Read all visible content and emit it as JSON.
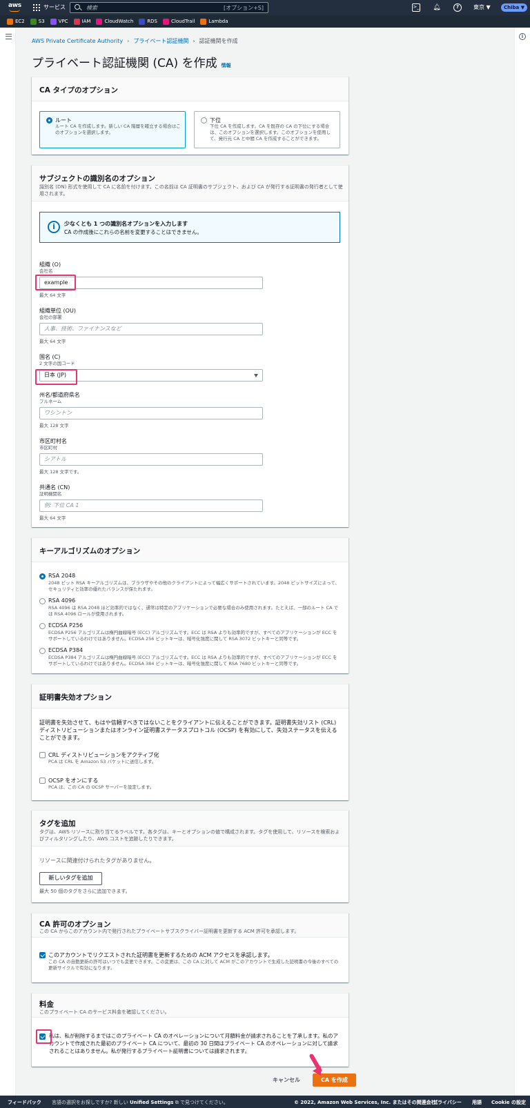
{
  "topnav": {
    "logo": "aws",
    "services": "サービス",
    "search_placeholder": "検索",
    "search_shortcut": "[オプション+S]",
    "region": "東京 ▼",
    "user": "Chiba ▼"
  },
  "favorites": [
    {
      "label": "EC2",
      "color": "#ec7211"
    },
    {
      "label": "S3",
      "color": "#3f8624"
    },
    {
      "label": "VPC",
      "color": "#8c4fff"
    },
    {
      "label": "IAM",
      "color": "#dd344c"
    },
    {
      "label": "CloudWatch",
      "color": "#e7157b"
    },
    {
      "label": "RDS",
      "color": "#3b48cc"
    },
    {
      "label": "CloudTrail",
      "color": "#e7157b"
    },
    {
      "label": "Lambda",
      "color": "#ec7211"
    }
  ],
  "breadcrumb": {
    "root": "AWS Private Certificate Authority",
    "parent": "プライベート認証機関",
    "current": "認証機関を作成"
  },
  "page": {
    "title": "プライベート認証機関 (CA) を作成",
    "info": "情報"
  },
  "ca_type": {
    "title": "CA タイプのオプション",
    "root": {
      "label": "ルート",
      "desc": "ルート CA を作成します。新しい CA 階層を確立する場合はこのオプションを選択します。"
    },
    "sub": {
      "label": "下位",
      "desc": "下位 CA を作成します。CA を既存の CA の下位にする場合は、このオプションを選択します。このオプションを使用して、発行元 CA と中間 CA を作成することができます。"
    }
  },
  "subject": {
    "title": "サブジェクトの識別名のオプション",
    "desc": "識別名 (DN) 形式を使用して CA に名前を付けます。この名前は CA 証明書のサブジェクト、および CA が発行する証明書の発行者として使用されます。",
    "alert_title": "少なくとも 1 つの識別名オプションを入力します",
    "alert_desc": "CA の作成後にこれらの名前を変更することはできません。",
    "org": {
      "label": "組織 (O)",
      "desc": "会社名",
      "value": "example",
      "limit": "最大 64 文字"
    },
    "ou": {
      "label": "組織単位 (OU)",
      "desc": "会社の部署",
      "placeholder": "人事、技術、ファイナンスなど",
      "limit": "最大 64 文字"
    },
    "country": {
      "label": "国名 (C)",
      "desc": "2 文字の国コード",
      "value": "日本 (JP)"
    },
    "state": {
      "label": "州名/都道府県名",
      "desc": "フルネーム",
      "placeholder": "ワシントン",
      "limit": "最大 128 文字"
    },
    "city": {
      "label": "市区町村名",
      "desc": "市区町村",
      "placeholder": "シアトル",
      "limit": "最大 128 文字です。"
    },
    "cn": {
      "label": "共通名 (CN)",
      "desc": "証明機関名",
      "placeholder": "例: 下位 CA 1",
      "limit": "最大 64 文字"
    }
  },
  "key_algo": {
    "title": "キーアルゴリズムのオプション",
    "options": [
      {
        "label": "RSA 2048",
        "desc": "2048 ビット RSA キーアルゴリズムは、ブラウザやその他のクライアントによって幅広くサポートされています。2048 ビットサイズによって、セキュリティと効率の優れたバランスが保たれます。",
        "selected": true
      },
      {
        "label": "RSA 4096",
        "desc": "RSA 4096 は RSA 2048 ほど効率的ではなく、通常は特定のアプリケーションで必要な場合のみ使用されます。たとえば、一部のルート CA では RSA 4096 ロールが使用されます。",
        "selected": false
      },
      {
        "label": "ECDSA P256",
        "desc": "ECDSA P256 アルゴリズムは楕円曲線暗号 (ECC) アルゴリズムです。ECC は RSA よりも効率的ですが、すべてのアプリケーションが ECC をサポートしているわけではありません。ECDSA 256 ビットキーは、暗号化強度に関して RSA 3072 ビットキーと同等です。",
        "selected": false
      },
      {
        "label": "ECDSA P384",
        "desc": "ECDSA P384 アルゴリズムは楕円曲線暗号 (ECC) アルゴリズムです。ECC は RSA よりも効率的ですが、すべてのアプリケーションが ECC をサポートしているわけではありません。ECDSA 384 ビットキーは、暗号化強度に関して RSA 7680 ビットキーと同等です。",
        "selected": false
      }
    ]
  },
  "revocation": {
    "title": "証明書失効オプション",
    "desc": "証明書を失効させて、もはや信頼すべきではないことをクライアントに伝えることができます。証明書失効リスト (CRL) ディストリビューションまたはオンライン証明書ステータスプロトコル (OCSP) を有効にして、失効ステータスを伝えることができます。",
    "crl": {
      "label": "CRL ディストリビューションをアクティブ化",
      "desc": "PCA は CRL を Amazon S3 バケットに送信します。"
    },
    "ocsp": {
      "label": "OCSP をオンにする",
      "desc": "PCA は、この CA の OCSP サーバーを設定します。"
    }
  },
  "tags": {
    "title": "タグを追加",
    "desc": "タグは、AWS リソースに割り当てるラベルです。各タグは、キーとオプションの値で構成されます。タグを使用して、リソースを検索およびフィルタリングしたり、AWS コストを追跡したりできます。",
    "empty": "リソースに関連付けられたタグがありません。",
    "add_button": "新しいタグを追加",
    "limit": "最大 50 個のタグをさらに追加できます。"
  },
  "permissions": {
    "title": "CA 許可のオプション",
    "desc": "この CA からこのアカウント内で発行されたプライベートサブスクライバー証明書を更新する ACM 許可を承認します。",
    "check_label": "このアカウントでリクエストされた証明書を更新するための ACM アクセスを承認します。",
    "check_desc": "この CA の自動更新の許可はいつでも変更できます。この変更は、この CA に対して ACM がこのアカウントで生成した証明書の今後のすべての更新サイクルで有効になります。"
  },
  "pricing": {
    "title": "料金",
    "desc": "このプライベート CA のサービス料金を確認してください。",
    "ack": "私は、私が削除するまではこのプライベート CA のオペレーションについて月額料金が請求されることを了承します。私のアカウントで作成された最初のプライベート CA について、最初の 30 日間はプライベート CA のオペレーションに対して請求されることはありません。私が発行するプライベート証明書については請求されます。"
  },
  "actions": {
    "cancel": "キャンセル",
    "create": "CA を作成"
  },
  "footer": {
    "feedback": "フィードバック",
    "lang_prefix": "言語の選択をお探しですか? 新しい",
    "lang_link": "Unified Settings",
    "lang_suffix": "で見つけてください。",
    "copyright": "© 2022, Amazon Web Services, Inc. またはその関連会社。",
    "privacy": "プライバシー",
    "terms": "用語",
    "cookie": "Cookie の設定"
  }
}
